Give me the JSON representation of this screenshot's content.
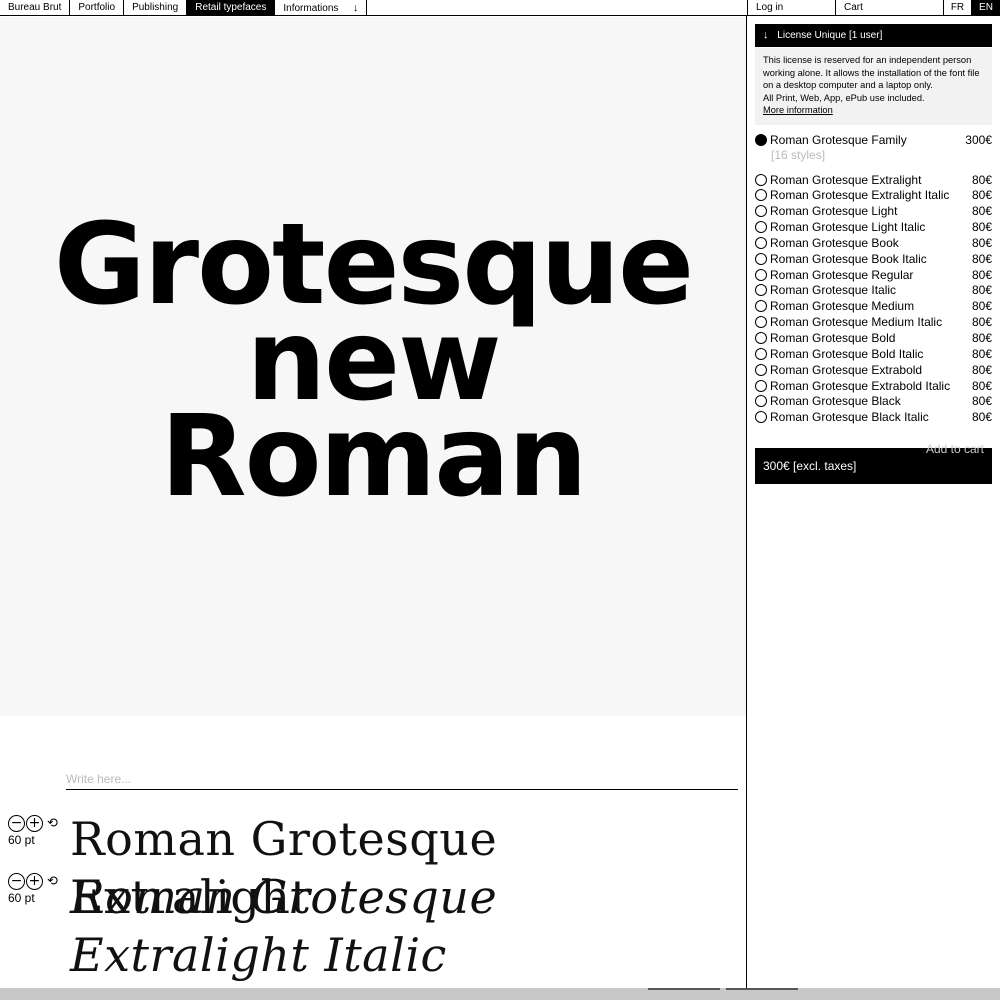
{
  "nav": {
    "left": [
      "Bureau Brut",
      "Portfolio",
      "Publishing",
      "Retail typefaces",
      "Informations"
    ],
    "active": "Retail typefaces",
    "login": "Log in",
    "cart": "Cart",
    "lang_fr": "FR",
    "lang_en": "EN",
    "active_lang": "EN"
  },
  "hero": {
    "line1": "Grotesque",
    "line2": "new",
    "line3": "Roman"
  },
  "tester": {
    "placeholder": "Write here...",
    "rows": [
      {
        "text": "Roman Grotesque Extralight",
        "size": "60 pt"
      },
      {
        "text": "Roman Grotesque Extralight Italic",
        "size": "60 pt"
      }
    ]
  },
  "license": {
    "title": "License Unique [1 user]",
    "desc": "This license is reserved for an independent person working alone. It allows the installation of the font file on a desktop computer and a laptop only.",
    "usage": "All Print, Web, App, ePub  use included.",
    "more": "More information"
  },
  "family": {
    "name": "Roman Grotesque Family",
    "price": "300€",
    "styles": "[16 styles]",
    "selected": true
  },
  "styles": [
    {
      "name": "Roman Grotesque Extralight",
      "price": "80€"
    },
    {
      "name": "Roman Grotesque Extralight Italic",
      "price": "80€"
    },
    {
      "name": "Roman Grotesque Light",
      "price": "80€"
    },
    {
      "name": "Roman Grotesque Light Italic",
      "price": "80€"
    },
    {
      "name": "Roman Grotesque Book",
      "price": "80€"
    },
    {
      "name": "Roman Grotesque Book Italic",
      "price": "80€"
    },
    {
      "name": "Roman Grotesque Regular",
      "price": "80€"
    },
    {
      "name": "Roman Grotesque Italic",
      "price": "80€"
    },
    {
      "name": "Roman Grotesque Medium",
      "price": "80€"
    },
    {
      "name": "Roman Grotesque Medium Italic",
      "price": "80€"
    },
    {
      "name": "Roman Grotesque Bold",
      "price": "80€"
    },
    {
      "name": "Roman Grotesque Bold Italic",
      "price": "80€"
    },
    {
      "name": "Roman Grotesque Extrabold",
      "price": "80€"
    },
    {
      "name": "Roman Grotesque Extrabold Italic",
      "price": "80€"
    },
    {
      "name": "Roman Grotesque Black",
      "price": "80€"
    },
    {
      "name": "Roman Grotesque Black Italic",
      "price": "80€"
    }
  ],
  "cart_button": {
    "label": "Add to cart",
    "total": "300€ [excl. taxes]"
  },
  "colors": {
    "accent": "#000000",
    "hero_bg": "#f7f7f7",
    "muted": "#bbbbbb"
  },
  "icons": {
    "minus": "minus-circle-icon",
    "plus": "plus-circle-icon",
    "reset": "reset-icon",
    "arrow": "arrow-down-icon"
  }
}
